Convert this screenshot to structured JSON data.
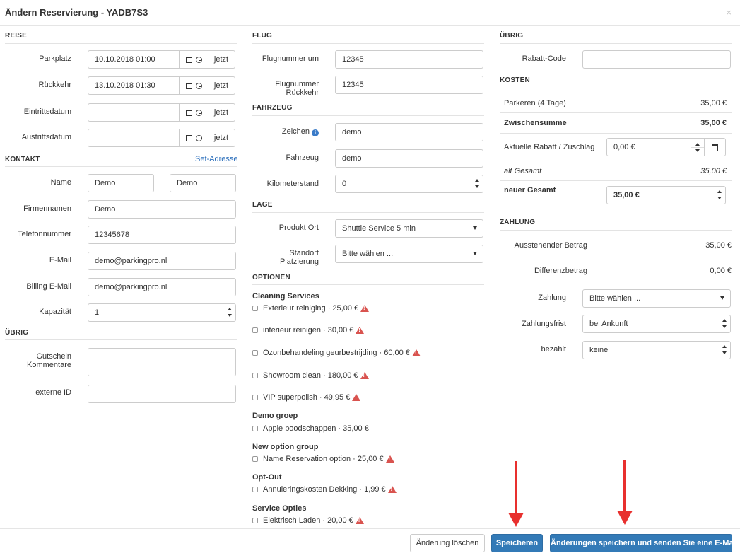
{
  "window": {
    "title": "Ändern Reservierung - YADB7S3",
    "close": "×"
  },
  "reise": {
    "section": "REISE",
    "parkplatz_label": "Parkplatz",
    "parkplatz_value": "10.10.2018 01:00",
    "rueckkehr_label": "Rückkehr",
    "rueckkehr_value": "13.10.2018 01:30",
    "eintritt_label": "Eintrittsdatum",
    "eintritt_value": "",
    "austritt_label": "Austrittsdatum",
    "austritt_value": "",
    "now_label": "jetzt"
  },
  "kontakt": {
    "section": "KONTAKT",
    "set_address": "Set-Adresse",
    "name_label": "Name",
    "firstname_value": "Demo",
    "lastname_value": "Demo",
    "company_label": "Firmennamen",
    "company_value": "Demo",
    "phone_label": "Telefonnummer",
    "phone_value": "12345678",
    "email_label": "E-Mail",
    "email_value": "demo@parkingpro.nl",
    "billing_label": "Billing E-Mail",
    "billing_value": "demo@parkingpro.nl",
    "capacity_label": "Kapazität",
    "capacity_value": "1"
  },
  "uebrig_left": {
    "section": "ÜBRIG",
    "comment_label_1": "Gutschein",
    "comment_label_2": "Kommentare",
    "comment_value": "",
    "external_label": "externe ID",
    "external_value": ""
  },
  "flug": {
    "section": "FLUG",
    "out_label": "Flugnummer um",
    "out_value": "12345",
    "ret_label_1": "Flugnummer",
    "ret_label_2": "Rückkehr",
    "ret_value": "12345"
  },
  "fahrzeug": {
    "section": "FAHRZEUG",
    "plate_label": "Zeichen",
    "plate_value": "demo",
    "vehicle_label": "Fahrzeug",
    "vehicle_value": "demo",
    "km_label": "Kilometerstand",
    "km_value": "0"
  },
  "lage": {
    "section": "LAGE",
    "product_label": "Produkt Ort",
    "product_value": "Shuttle Service 5 min",
    "location_label_1": "Standort",
    "location_label_2": "Platzierung",
    "location_value": "Bitte wählen ..."
  },
  "optionen": {
    "section": "OPTIONEN",
    "groups": [
      {
        "title": "Cleaning Services",
        "items": [
          {
            "label": "Exterieur reiniging · 25,00 €",
            "warn": true
          },
          {
            "label": "interieur reinigen · 30,00 €",
            "warn": true
          },
          {
            "label": "Ozonbehandeling geurbestrijding · 60,00 €",
            "warn": true
          },
          {
            "label": "Showroom clean · 180,00 €",
            "warn": true
          },
          {
            "label": "VIP superpolish · 49,95 €",
            "warn": true
          }
        ]
      },
      {
        "title": "Demo groep",
        "items": [
          {
            "label": "Appie boodschappen · 35,00 €",
            "warn": false
          }
        ]
      },
      {
        "title": "New option group",
        "items": [
          {
            "label": "Name Reservation option · 25,00 €",
            "warn": true
          }
        ]
      },
      {
        "title": "Opt-Out",
        "items": [
          {
            "label": "Annuleringskosten Dekking · 1,99 €",
            "warn": true
          }
        ]
      },
      {
        "title": "Service Opties",
        "items": [
          {
            "label": "Elektrisch Laden · 20,00 €",
            "warn": true
          }
        ]
      }
    ]
  },
  "uebrig_right": {
    "section": "ÜBRIG",
    "discount_label": "Rabatt-Code",
    "discount_value": ""
  },
  "kosten": {
    "section": "KOSTEN",
    "parking_label": "Parkeren (4 Tage)",
    "parking_value": "35,00 €",
    "subtotal_label": "Zwischensumme",
    "subtotal_value": "35,00 €",
    "adjust_label": "Aktuelle Rabatt / Zuschlag",
    "adjust_value": "0,00 €",
    "old_total_label": "alt Gesamt",
    "old_total_value": "35,00 €",
    "new_total_label": "neuer Gesamt",
    "new_total_value": "35,00 €"
  },
  "zahlung": {
    "section": "ZAHLUNG",
    "outstanding_label": "Ausstehender Betrag",
    "outstanding_value": "35,00 €",
    "difference_label": "Differenzbetrag",
    "difference_value": "0,00 €",
    "payment_label": "Zahlung",
    "payment_value": "Bitte wählen ...",
    "term_label": "Zahlungsfrist",
    "term_value": "bei Ankunft",
    "paid_label": "bezahlt",
    "paid_value": "keine"
  },
  "footer": {
    "discard": "Änderung löschen",
    "save": "Speicheren",
    "save_email": "Änderungen speichern und senden Sie eine E-Mail"
  },
  "colors": {
    "primary": "#337ab7",
    "arrow": "#e8302e",
    "warning": "#d9534f",
    "link": "#2a6ebb"
  }
}
